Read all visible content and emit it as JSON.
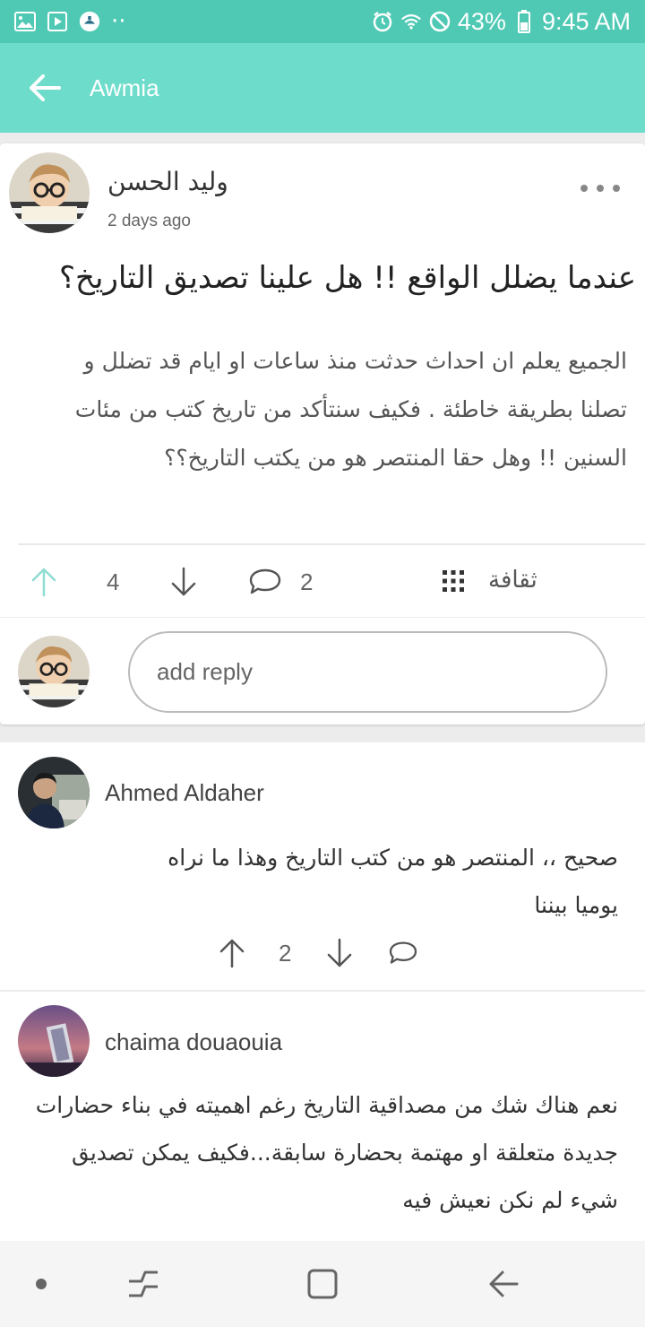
{
  "status_bar": {
    "battery": "43%",
    "time": "9:45 AM",
    "dots": "··"
  },
  "app_bar": {
    "title": "Awmia"
  },
  "post": {
    "author": "وليد الحسن",
    "time": "2 days ago",
    "title": "عندما يضلل الواقع !! هل علينا تصديق التاريخ؟",
    "body": "الجميع يعلم ان احداث حدثت منذ ساعات او ايام قد تضلل و تصلنا بطريقة خاطئة . فكيف سنتأكد من تاريخ كتب من مئات السنين !! وهل حقا  المنتصر هو من يكتب التاريخ؟؟",
    "votes": "4",
    "comments": "2",
    "category": "ثقافة",
    "reply_placeholder": "add reply"
  },
  "comments": [
    {
      "author": "Ahmed Aldaher",
      "body": "صحيح ،، المنتصر هو من كتب التاريخ وهذا ما نراه  يوميا بيننا",
      "votes": "2"
    },
    {
      "author": "chaima douaouia",
      "body": "نعم هناك شك من مصداقية التاريخ رغم اهميته في بناء حضارات جديدة متعلقة او مهتمة بحضارة سابقة...فكيف يمكن تصديق شيء لم نكن نعيش فيه"
    }
  ],
  "colors": {
    "status_bar": "#4fc9b4",
    "app_bar": "#6edccb",
    "accent": "#7fd8ce"
  }
}
